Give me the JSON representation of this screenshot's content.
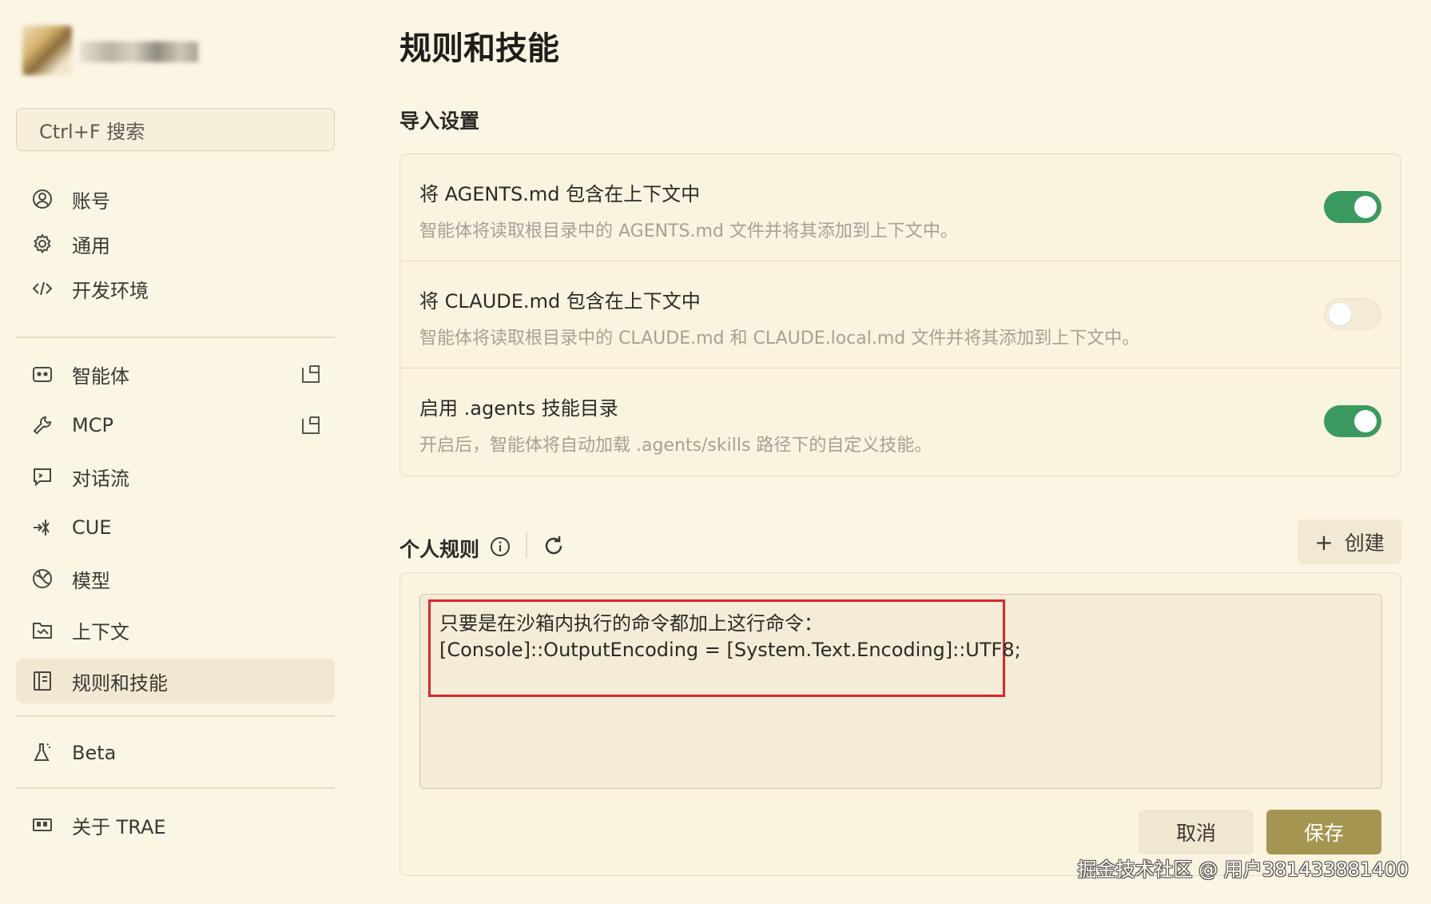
{
  "sidebar": {
    "search_placeholder": "Ctrl+F 搜索",
    "items": [
      {
        "label": "账号",
        "icon": "user-circle-icon"
      },
      {
        "label": "通用",
        "icon": "gear-icon"
      },
      {
        "label": "开发环境",
        "icon": "code-icon"
      },
      {
        "label": "智能体",
        "icon": "robot-icon"
      },
      {
        "label": "MCP",
        "icon": "wrench-icon"
      },
      {
        "label": "对话流",
        "icon": "chat-flow-icon"
      },
      {
        "label": "CUE",
        "icon": "cue-icon"
      },
      {
        "label": "模型",
        "icon": "model-icon"
      },
      {
        "label": "上下文",
        "icon": "context-icon"
      },
      {
        "label": "规则和技能",
        "icon": "rules-book-icon"
      },
      {
        "label": "Beta",
        "icon": "flask-icon"
      },
      {
        "label": "关于 TRAE",
        "icon": "about-icon"
      }
    ],
    "active_item": "规则和技能"
  },
  "main": {
    "title": "规则和技能",
    "import_section": {
      "title": "导入设置",
      "rows": [
        {
          "title": "将 AGENTS.md 包含在上下文中",
          "desc": "智能体将读取根目录中的 AGENTS.md 文件并将其添加到上下文中。",
          "enabled": true
        },
        {
          "title": "将 CLAUDE.md 包含在上下文中",
          "desc": "智能体将读取根目录中的 CLAUDE.md 和 CLAUDE.local.md 文件并将其添加到上下文中。",
          "enabled": false
        },
        {
          "title": "启用 .agents 技能目录",
          "desc": "开启后，智能体将自动加载 .agents/skills 路径下的自定义技能。",
          "enabled": true
        }
      ]
    },
    "personal_rules": {
      "title": "个人规则",
      "create_label": "创建",
      "content_lines": [
        "只要是在沙箱内执行的命令都加上这行命令：",
        "[Console]::OutputEncoding = [System.Text.Encoding]::UTF8;"
      ],
      "cancel_label": "取消",
      "save_label": "保存"
    }
  },
  "watermark": "掘金技术社区 @ 用户381433881400",
  "colors": {
    "background": "#fbf5e4",
    "toggle_on": "#3a9a5f",
    "save_button": "#a49651",
    "highlight_border": "#d9272e"
  }
}
